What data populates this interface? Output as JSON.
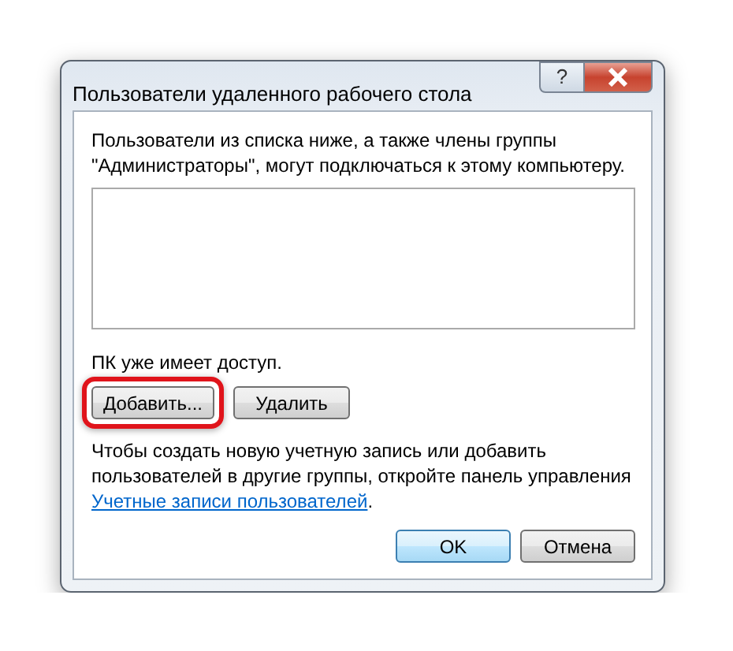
{
  "window": {
    "title": "Пользователи удаленного рабочего стола",
    "help_button": "?"
  },
  "intro": "Пользователи из списка ниже, а также члены группы \"Администраторы\", могут подключаться к этому компьютеру.",
  "status": "ПК уже имеет доступ.",
  "list_buttons": [
    {
      "label": "Добавить...",
      "highlighted": true
    },
    {
      "label": "Удалить",
      "highlighted": false
    }
  ],
  "hint": {
    "text": "Чтобы создать новую учетную запись или добавить пользователей в другие группы, откройте панель управления",
    "link": "Учетные записи пользователей",
    "after": "."
  },
  "buttons": [
    {
      "label": "OK",
      "default": true
    },
    {
      "label": "Отмена",
      "default": false
    }
  ]
}
